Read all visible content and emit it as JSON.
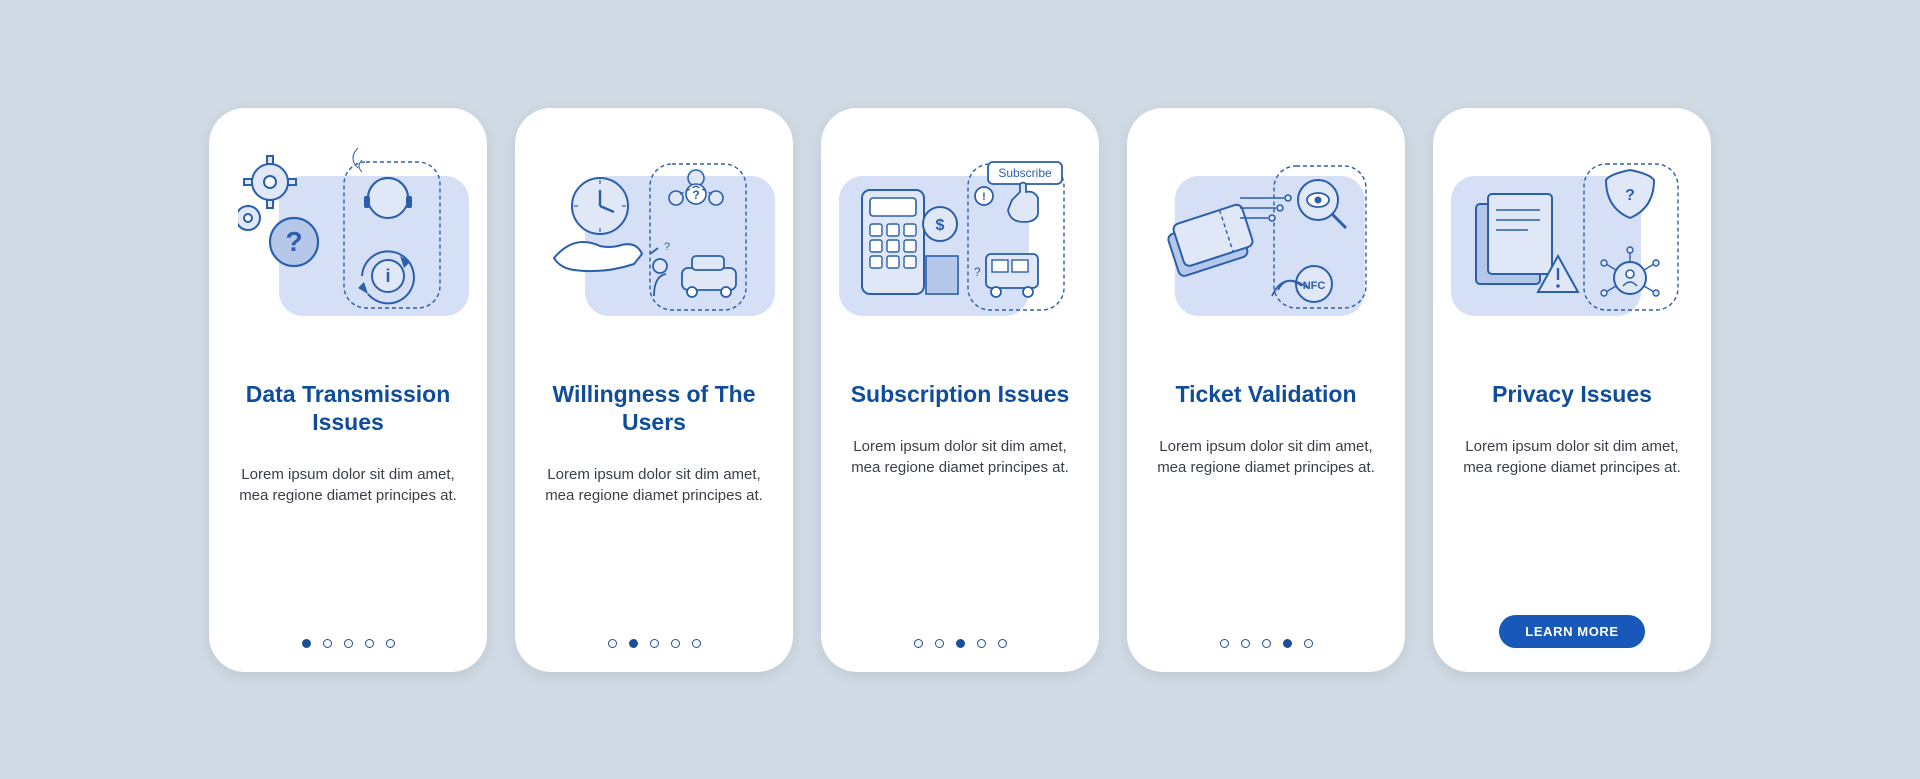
{
  "colors": {
    "primary": "#1858b8",
    "accent": "#0f4d9a",
    "illus_bg": "#d5dff5",
    "stroke": "#2b5fab",
    "fill_light": "#e0e8f7",
    "fill_mid": "#b6c8ea"
  },
  "cards": [
    {
      "title": "Data Transmission Issues",
      "body": "Lorem ipsum dolor sit dim amet, mea regione diamet principes at.",
      "icon_set": "data-transmission",
      "dots_total": 5,
      "active_dot": 0
    },
    {
      "title": "Willingness of The Users",
      "body": "Lorem ipsum dolor sit dim amet, mea regione diamet principes at.",
      "icon_set": "willingness",
      "dots_total": 5,
      "active_dot": 1
    },
    {
      "title": "Subscription Issues",
      "body": "Lorem ipsum dolor sit dim amet, mea regione diamet principes at.",
      "icon_set": "subscription",
      "dots_total": 5,
      "active_dot": 2
    },
    {
      "title": "Ticket Validation",
      "body": "Lorem ipsum dolor sit dim amet, mea regione diamet principes at.",
      "icon_set": "ticket-validation",
      "dots_total": 5,
      "active_dot": 3
    },
    {
      "title": "Privacy Issues",
      "body": "Lorem ipsum dolor sit dim amet, mea regione diamet principes at.",
      "icon_set": "privacy",
      "dots_total": 5,
      "active_dot": 4,
      "cta_label": "LEARN MORE"
    }
  ]
}
